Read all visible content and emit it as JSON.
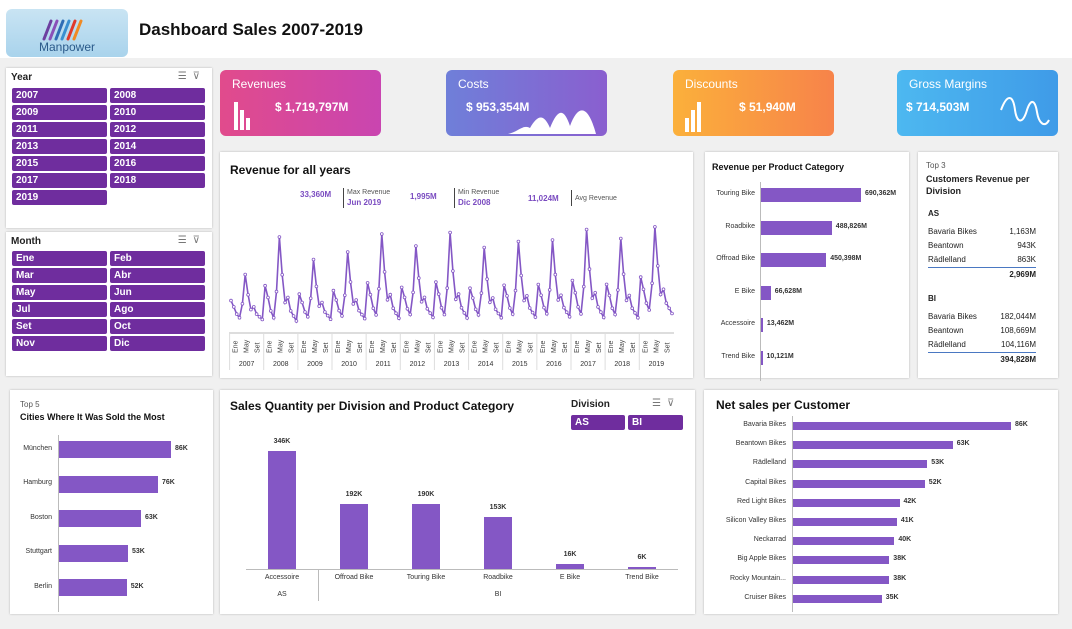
{
  "header": {
    "title": "Dashboard Sales 2007-2019",
    "logo_text": "Manpower"
  },
  "colors": {
    "accent": "#6f2d9e",
    "bar": "#8457c5",
    "line": "#8457c5"
  },
  "year_slicer": {
    "title": "Year",
    "items": [
      "2007",
      "2008",
      "2009",
      "2010",
      "2011",
      "2012",
      "2013",
      "2014",
      "2015",
      "2016",
      "2017",
      "2018",
      "2019"
    ]
  },
  "month_slicer": {
    "title": "Month",
    "items": [
      "Ene",
      "Feb",
      "Mar",
      "Abr",
      "May",
      "Jun",
      "Jul",
      "Ago",
      "Set",
      "Oct",
      "Nov",
      "Dic"
    ]
  },
  "kpis": [
    {
      "label": "Revenues",
      "value": "$ 1,719,797M",
      "icon": "bars-icon"
    },
    {
      "label": "Costs",
      "value": "$ 953,354M",
      "icon": "wave-area-icon"
    },
    {
      "label": "Discounts",
      "value": "$ 51,940M",
      "icon": "bars-icon"
    },
    {
      "label": "Gross Margins",
      "value": "$ 714,503M",
      "icon": "squiggle-icon"
    }
  ],
  "revenue_panel": {
    "title": "Revenue for all years",
    "max": {
      "value": "33,360M",
      "label": "Max Revenue",
      "sub": "Jun  2019"
    },
    "min": {
      "value": "1,995M",
      "label": "Min Revenue",
      "sub": "Dic  2008"
    },
    "avg": {
      "value": "11,024M",
      "label": "Avg Revenue"
    }
  },
  "product_panel": {
    "title": "Revenue per Product Category"
  },
  "customers_panel": {
    "top_label": "Top 3",
    "title": "Customers Revenue per Division",
    "groups": [
      {
        "name": "AS",
        "rows": [
          {
            "name": "Bavaria Bikes",
            "value": "1,163M"
          },
          {
            "name": "Beantown",
            "value": "943K"
          },
          {
            "name": "Rädlelland",
            "value": "863K"
          }
        ],
        "total": "2,969M"
      },
      {
        "name": "BI",
        "rows": [
          {
            "name": "Bavaria Bikes",
            "value": "182,044M"
          },
          {
            "name": "Beantown",
            "value": "108,669M"
          },
          {
            "name": "Rädlelland",
            "value": "104,116M"
          }
        ],
        "total": "394,828M"
      }
    ]
  },
  "cities_panel": {
    "top_label": "Top 5",
    "title": "Cities Where It Was Sold the Most"
  },
  "quantity_panel": {
    "title": "Sales Quantity per Division and Product Category",
    "division_title": "Division",
    "division_items": [
      "AS",
      "BI"
    ]
  },
  "customer_panel": {
    "title": "Net sales per Customer"
  },
  "chart_data": [
    {
      "type": "line",
      "title": "Revenue for all years",
      "x_groups": [
        "2007",
        "2008",
        "2009",
        "2010",
        "2011",
        "2012",
        "2013",
        "2014",
        "2015",
        "2016",
        "2017",
        "2018",
        "2019"
      ],
      "x_month_ticks": [
        "Ene",
        "May",
        "Set"
      ],
      "ylim": [
        0,
        35000
      ],
      "peaks": [
        17500,
        30000,
        22500,
        25000,
        31000,
        27000,
        31500,
        26500,
        28500,
        29000,
        32500,
        29500,
        33360
      ],
      "troughs": [
        2500,
        1995,
        2600,
        2800,
        2900,
        3200,
        3000,
        3100,
        3300,
        3400,
        3200,
        3100,
        4500
      ]
    },
    {
      "type": "bar",
      "title": "Revenue per Product Category",
      "categories": [
        "Touring Bike",
        "Roadbike",
        "Offroad Bike",
        "E Bike",
        "Accessoire",
        "Trend Bike"
      ],
      "values": [
        690362,
        488826,
        450398,
        66628,
        13462,
        10121
      ],
      "labels": [
        "690,362M",
        "488,826M",
        "450,398M",
        "66,628M",
        "13,462M",
        "10,121M"
      ]
    },
    {
      "type": "bar",
      "title": "Cities Where It Was Sold the Most",
      "categories": [
        "München",
        "Hamburg",
        "Boston",
        "Stuttgart",
        "Berlin"
      ],
      "values": [
        86,
        76,
        63,
        53,
        52
      ],
      "labels": [
        "86K",
        "76K",
        "63K",
        "53K",
        "52K"
      ]
    },
    {
      "type": "bar",
      "title": "Sales Quantity per Division and Product Category",
      "categories": [
        "Accessoire",
        "Offroad Bike",
        "Touring Bike",
        "Roadbike",
        "E Bike",
        "Trend Bike"
      ],
      "groups": [
        "AS",
        "BI"
      ],
      "values": [
        346,
        192,
        190,
        153,
        16,
        6
      ],
      "labels": [
        "346K",
        "192K",
        "190K",
        "153K",
        "16K",
        "6K"
      ]
    },
    {
      "type": "bar",
      "title": "Net sales per Customer",
      "categories": [
        "Bavaria Bikes",
        "Beantown Bikes",
        "Rädlelland",
        "Capital Bikes",
        "Red Light Bikes",
        "Silicon Valley Bikes",
        "Neckarrad",
        "Big Apple Bikes",
        "Rocky Mountain...",
        "Cruiser Bikes"
      ],
      "values": [
        86,
        63,
        53,
        52,
        42,
        41,
        40,
        38,
        38,
        35
      ],
      "labels": [
        "86K",
        "63K",
        "53K",
        "52K",
        "42K",
        "41K",
        "40K",
        "38K",
        "38K",
        "35K"
      ]
    }
  ]
}
